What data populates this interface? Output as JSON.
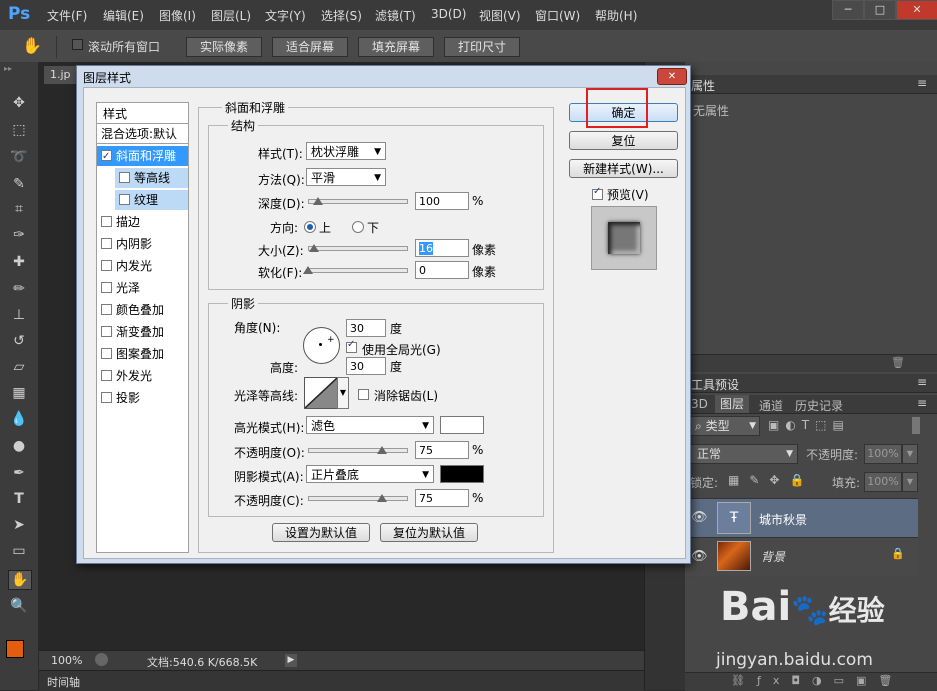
{
  "app": {
    "logo": "Ps"
  },
  "menu": [
    "文件(F)",
    "编辑(E)",
    "图像(I)",
    "图层(L)",
    "文字(Y)",
    "选择(S)",
    "滤镜(T)",
    "3D(D)",
    "视图(V)",
    "窗口(W)",
    "帮助(H)"
  ],
  "window_controls": [
    "─",
    "□",
    "✕"
  ],
  "options": {
    "scroll_all": "滚动所有窗口",
    "actual_pixels": "实际像素",
    "fit_screen": "适合屏幕",
    "fill_screen": "填充屏幕",
    "print_size": "打印尺寸"
  },
  "document": {
    "tab": "1.jp",
    "zoom": "100%",
    "doc_info": "文档:540.6 K/668.5K",
    "timeline": "时间轴"
  },
  "dialog": {
    "title": "图层样式",
    "close": "✕",
    "sidebar": {
      "header": "样式",
      "items": [
        {
          "label": "混合选项:默认",
          "checkbox": false,
          "checked": false,
          "selected": false,
          "indent": false
        },
        {
          "label": "斜面和浮雕",
          "checkbox": true,
          "checked": true,
          "selected": true,
          "indent": false
        },
        {
          "label": "等高线",
          "checkbox": true,
          "checked": false,
          "selected": true,
          "indent": true
        },
        {
          "label": "纹理",
          "checkbox": true,
          "checked": false,
          "selected": true,
          "indent": true
        },
        {
          "label": "描边",
          "checkbox": true,
          "checked": false,
          "selected": false,
          "indent": false
        },
        {
          "label": "内阴影",
          "checkbox": true,
          "checked": false,
          "selected": false,
          "indent": false
        },
        {
          "label": "内发光",
          "checkbox": true,
          "checked": false,
          "selected": false,
          "indent": false
        },
        {
          "label": "光泽",
          "checkbox": true,
          "checked": false,
          "selected": false,
          "indent": false
        },
        {
          "label": "颜色叠加",
          "checkbox": true,
          "checked": false,
          "selected": false,
          "indent": false
        },
        {
          "label": "渐变叠加",
          "checkbox": true,
          "checked": false,
          "selected": false,
          "indent": false
        },
        {
          "label": "图案叠加",
          "checkbox": true,
          "checked": false,
          "selected": false,
          "indent": false
        },
        {
          "label": "外发光",
          "checkbox": true,
          "checked": false,
          "selected": false,
          "indent": false
        },
        {
          "label": "投影",
          "checkbox": true,
          "checked": false,
          "selected": false,
          "indent": false
        }
      ]
    },
    "bevel": {
      "title": "斜面和浮雕",
      "structure": {
        "title": "结构",
        "style_label": "样式(T):",
        "style_value": "枕状浮雕",
        "technique_label": "方法(Q):",
        "technique_value": "平滑",
        "depth_label": "深度(D):",
        "depth_value": "100",
        "depth_unit": "%",
        "depth_fraction": 0.1,
        "direction_label": "方向:",
        "direction_up": "上",
        "direction_down": "下",
        "size_label": "大小(Z):",
        "size_value": "16",
        "size_unit": "像素",
        "size_fraction": 0.06,
        "soften_label": "软化(F):",
        "soften_value": "0",
        "soften_unit": "像素",
        "soften_fraction": 0
      },
      "shading": {
        "title": "阴影",
        "angle_label": "角度(N):",
        "angle_value": "30",
        "angle_unit": "度",
        "global_light": "使用全局光(G)",
        "altitude_label": "高度:",
        "altitude_value": "30",
        "altitude_unit": "度",
        "gloss_label": "光泽等高线:",
        "anti_alias": "消除锯齿(L)",
        "highlight_label": "高光模式(H):",
        "highlight_value": "滤色",
        "highlight_color": "#ffffff",
        "highlight_opacity_label": "不透明度(O):",
        "highlight_opacity_value": "75",
        "highlight_opacity_fraction": 0.75,
        "shadow_label": "阴影模式(A):",
        "shadow_value": "正片叠底",
        "shadow_color": "#000000",
        "shadow_opacity_label": "不透明度(C):",
        "shadow_opacity_value": "75",
        "shadow_opacity_fraction": 0.75,
        "percent": "%"
      },
      "make_default": "设置为默认值",
      "reset_default": "复位为默认值"
    },
    "buttons": {
      "ok": "确定",
      "reset": "复位",
      "new_style": "新建样式(W)...",
      "preview": "预览(V)"
    }
  },
  "properties": {
    "title": "属性",
    "empty": "无属性"
  },
  "tool_presets": {
    "title": "工具预设"
  },
  "layers": {
    "tabs": [
      "3D",
      "图层",
      "通道",
      "历史记录"
    ],
    "filter": "类型",
    "blend": "正常",
    "opacity_label": "不透明度:",
    "opacity_value": "100%",
    "lock_label": "锁定:",
    "fill_label": "填充:",
    "fill_value": "100%",
    "items": [
      {
        "name": "城市秋景",
        "type": "text"
      },
      {
        "name": "背景",
        "type": "image"
      }
    ]
  },
  "watermark": {
    "brand": "Bai",
    "brand2": "经验",
    "url": "jingyan.baidu.com"
  },
  "colors": {
    "accent": "#3399ff",
    "highlight_box": "#e02020",
    "fg_swatch": "#e35c10",
    "selected_item": "#3399ff",
    "selected_sub": "#bcd9f6"
  }
}
